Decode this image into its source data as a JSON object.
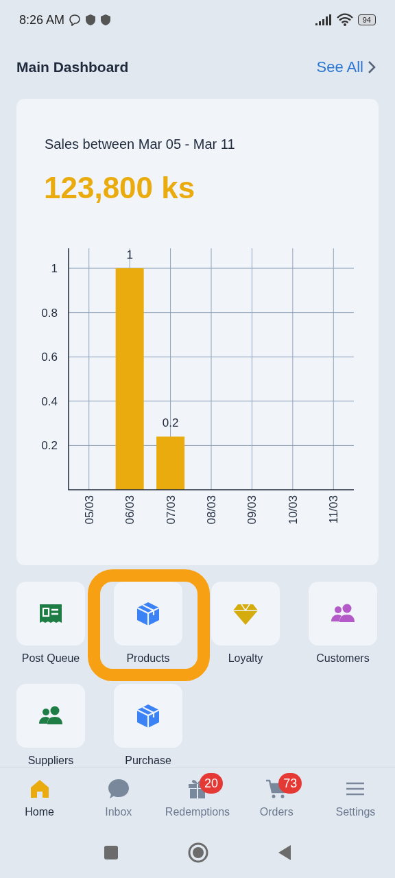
{
  "status_bar": {
    "time": "8:26 AM",
    "battery": "94"
  },
  "header": {
    "title": "Main Dashboard",
    "link": "See All"
  },
  "sales_card": {
    "title": "Sales between Mar 05 - Mar 11",
    "total": "123,800 ks",
    "chart_data": {
      "type": "bar",
      "categories": [
        "05/03",
        "06/03",
        "07/03",
        "08/03",
        "09/03",
        "10/03",
        "11/03"
      ],
      "grid": true,
      "series": [
        {
          "color": "#eaab0e",
          "values": [
            0,
            1,
            0.24,
            0,
            0,
            0,
            0
          ]
        }
      ],
      "ylim": [
        0,
        1.09
      ],
      "yticks": [
        0.2,
        0.4,
        0.6,
        0.8,
        1
      ],
      "value_labels": [
        null,
        "1",
        "0.2",
        null,
        null,
        null,
        null
      ]
    }
  },
  "shortcuts": [
    {
      "label": "Post Queue",
      "kind": "receipt",
      "color": "#1e7d45",
      "highlighted": false
    },
    {
      "label": "Products",
      "kind": "box",
      "color": "#3b82f6",
      "highlighted": true
    },
    {
      "label": "Loyalty",
      "kind": "diamond",
      "color": "#d4ac0d",
      "highlighted": false
    },
    {
      "label": "Customers",
      "kind": "people",
      "color": "#b45ac8",
      "highlighted": false
    },
    {
      "label": "Suppliers",
      "kind": "people",
      "color": "#1e7d45",
      "highlighted": false
    },
    {
      "label": "Purchase",
      "kind": "box",
      "color": "#3b82f6",
      "highlighted": false
    }
  ],
  "bottom_nav": [
    {
      "label": "Home",
      "kind": "home",
      "selected": true
    },
    {
      "label": "Inbox",
      "kind": "chat",
      "selected": false
    },
    {
      "label": "Redemptions",
      "kind": "gift",
      "selected": false,
      "badge": "20"
    },
    {
      "label": "Orders",
      "kind": "cart",
      "selected": false,
      "badge": "73"
    },
    {
      "label": "Settings",
      "kind": "menu",
      "selected": false
    }
  ]
}
